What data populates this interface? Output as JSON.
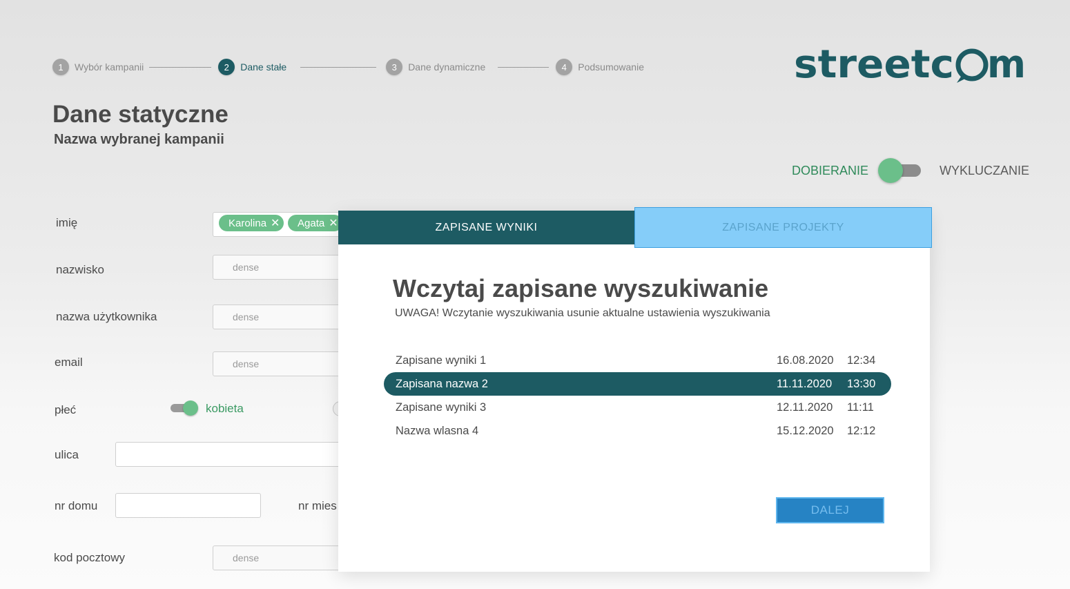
{
  "stepper": {
    "steps": [
      {
        "num": "1",
        "label": "Wybór kampanii"
      },
      {
        "num": "2",
        "label": "Dane stałe"
      },
      {
        "num": "3",
        "label": "Dane dynamiczne"
      },
      {
        "num": "4",
        "label": "Podsumowanie"
      }
    ],
    "active_index": 1
  },
  "brand": {
    "logo": "streetcom",
    "color": "#1d5b63"
  },
  "header": {
    "title": "Dane statyczne",
    "subtitle": "Nazwa wybranej kampanii"
  },
  "mode": {
    "left_label": "DOBIERANIE",
    "right_label": "WYKLUCZANIE",
    "selected": "DOBIERANIE"
  },
  "form": {
    "name_label": "imię",
    "name_chips": [
      "Karolina",
      "Agata"
    ],
    "surname_label": "nazwisko",
    "surname_placeholder": "dense",
    "username_label": "nazwa użytkownika",
    "username_placeholder": "dense",
    "email_label": "email",
    "email_placeholder": "dense",
    "gender_label": "płeć",
    "gender_option": "kobieta",
    "street_label": "ulica",
    "house_label": "nr domu",
    "flat_label": "nr mies",
    "postal_label": "kod pocztowy",
    "postal_placeholder": "dense"
  },
  "modal": {
    "tabs": {
      "saved_results": "ZAPISANE WYNIKI",
      "saved_projects": "ZAPISANE PROJEKTY"
    },
    "title": "Wczytaj zapisane wyszukiwanie",
    "warning": "UWAGA! Wczytanie wyszukiwania usunie aktualne ustawienia wyszukiwania",
    "results": [
      {
        "name": "Zapisane wyniki 1",
        "date": "16.08.2020",
        "time": "12:34"
      },
      {
        "name": "Zapisana nazwa 2",
        "date": "11.11.2020",
        "time": "13:30"
      },
      {
        "name": "Zapisane wyniki 3",
        "date": "12.11.2020",
        "time": "11:11"
      },
      {
        "name": "Nazwa wlasna 4",
        "date": "15.12.2020",
        "time": "12:12"
      }
    ],
    "selected_index": 1,
    "next_label": "DALEJ"
  },
  "colors": {
    "primary": "#1d5b63",
    "accent_green": "#6bbf8a",
    "highlight_blue": "#85cdf9",
    "button_blue": "#2683c4"
  }
}
